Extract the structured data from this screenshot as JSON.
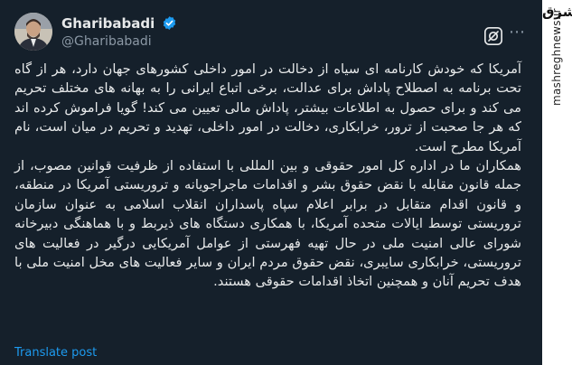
{
  "post": {
    "display_name": "Gharibabadi",
    "handle": "@Gharibabadi",
    "paragraph_1": "آمریکا که خودش کارنامه ای سیاه از دخالت در امور داخلی کشورهای جهان دارد، هر از گاه تحت برنامه به اصطلاح پاداش برای عدالت، برخی اتباع ایرانی را به بهانه های مختلف تحریم می کند و برای حصول به اطلاعات بیشتر، پاداش مالی تعیین می کند! گویا فراموش کرده اند که هر جا صحبت از ترور، خرابکاری، دخالت در امور داخلی، تهدید و تحریم در میان است، نام آمریکا مطرح است.",
    "paragraph_2": "همکاران ما در اداره کل امور حقوقی و بین المللی با استفاده از ظرفیت قوانین مصوب، از جمله قانون مقابله با نقض حقوق بشر و اقدامات ماجراجویانه و تروریستی آمریکا در منطقه، و قانون اقدام متقابل در برابر اعلام سپاه پاسداران انقلاب اسلامی به عنوان سازمان تروریستی توسط ایالات متحده آمریکا، با همکاری دستگاه های ذیربط و با هماهنگی دبیرخانه شورای عالی امنیت ملی در حال تهیه فهرستی از عوامل آمریکایی درگیر در فعالیت های تروریستی، خرابکاری سایبری، نقض حقوق مردم ایران و سایر فعالیت های مخل امنیت ملی با هدف تحریم آنان و همچنین اتخاذ اقدامات حقوقی هستند.",
    "translate_label": "Translate post",
    "icons": [
      "avatar",
      "verified-badge-icon",
      "grok-icon",
      "more-icon"
    ]
  },
  "watermark": {
    "logo_text": "مشرق",
    "url": "mashreghnews.ir"
  },
  "colors": {
    "background": "#15202b",
    "text": "#e7e9ea",
    "muted": "#8b98a5",
    "link": "#1d9bf0",
    "verified": "#1d9bf0"
  }
}
